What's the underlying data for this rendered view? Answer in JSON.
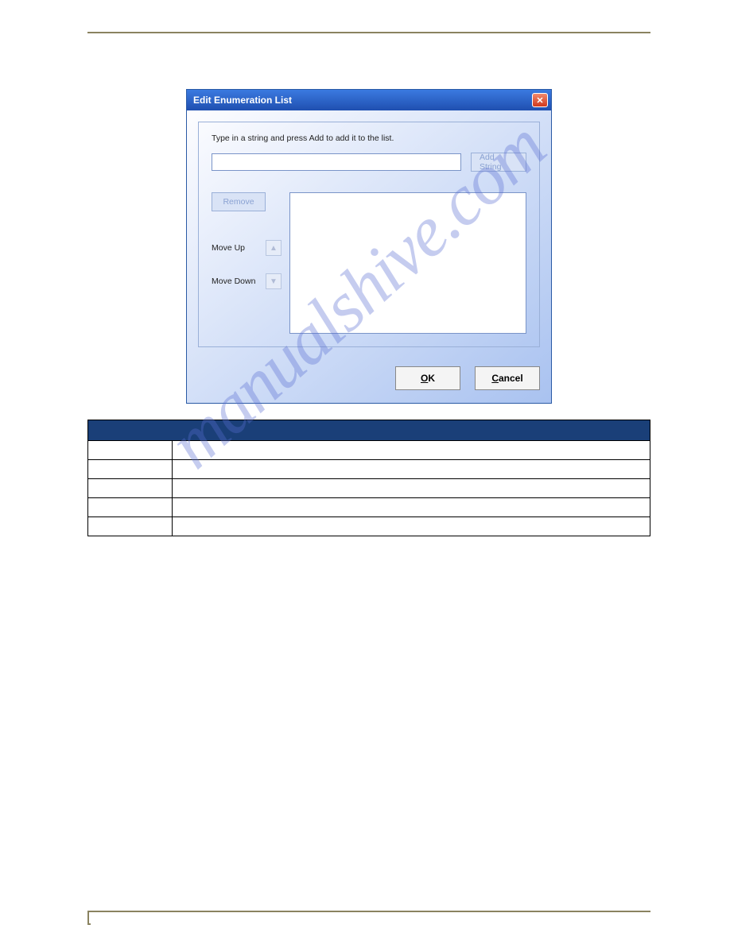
{
  "watermark": "manualshive.com",
  "dialog": {
    "title": "Edit Enumeration List",
    "instruction": "Type in a string and press Add to add it to the list.",
    "add_label": "Add String",
    "remove_label": "Remove",
    "move_up_label": "Move Up",
    "move_down_label": "Move Down",
    "ok_label": "OK",
    "ok_underline": "O",
    "ok_rest": "K",
    "cancel_label": "Cancel",
    "cancel_underline": "C",
    "cancel_rest": "ancel"
  },
  "table": {
    "rows": [
      {
        "c1": "",
        "c2": ""
      },
      {
        "c1": "",
        "c2": ""
      },
      {
        "c1": "",
        "c2": ""
      },
      {
        "c1": "",
        "c2": ""
      },
      {
        "c1": "",
        "c2": ""
      }
    ]
  }
}
